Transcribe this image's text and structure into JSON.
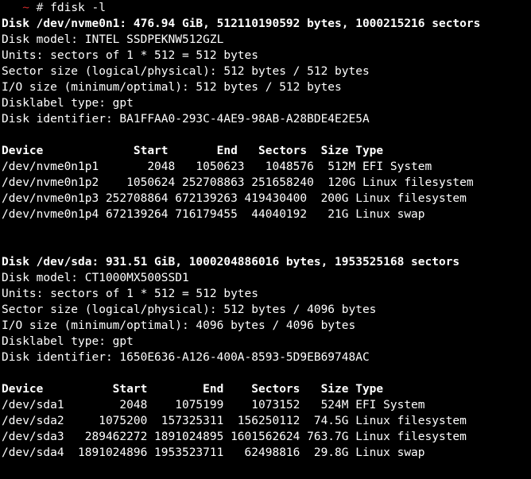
{
  "prompt": {
    "prefix": "   ",
    "tilde": "~",
    "hash": " # ",
    "command": "fdisk -l"
  },
  "disks": [
    {
      "header": "Disk /dev/nvme0n1: 476.94 GiB, 512110190592 bytes, 1000215216 sectors",
      "info": [
        "Disk model: INTEL SSDPEKNW512GZL",
        "Units: sectors of 1 * 512 = 512 bytes",
        "Sector size (logical/physical): 512 bytes / 512 bytes",
        "I/O size (minimum/optimal): 512 bytes / 512 bytes",
        "Disklabel type: gpt",
        "Disk identifier: BA1FFAA0-293C-4AE9-98AB-A28BDE4E2E5A"
      ],
      "table_header": "Device             Start       End   Sectors  Size Type",
      "rows": [
        "/dev/nvme0n1p1       2048   1050623   1048576  512M EFI System",
        "/dev/nvme0n1p2    1050624 252708863 251658240  120G Linux filesystem",
        "/dev/nvme0n1p3 252708864 672139263 419430400  200G Linux filesystem",
        "/dev/nvme0n1p4 672139264 716179455  44040192   21G Linux swap"
      ]
    },
    {
      "header": "Disk /dev/sda: 931.51 GiB, 1000204886016 bytes, 1953525168 sectors",
      "info": [
        "Disk model: CT1000MX500SSD1",
        "Units: sectors of 1 * 512 = 512 bytes",
        "Sector size (logical/physical): 512 bytes / 4096 bytes",
        "I/O size (minimum/optimal): 4096 bytes / 4096 bytes",
        "Disklabel type: gpt",
        "Disk identifier: 1650E636-A126-400A-8593-5D9EB69748AC"
      ],
      "table_header": "Device          Start        End    Sectors   Size Type",
      "rows": [
        "/dev/sda1        2048    1075199    1073152   524M EFI System",
        "/dev/sda2     1075200  157325311  156250112  74.5G Linux filesystem",
        "/dev/sda3   289462272 1891024895 1601562624 763.7G Linux filesystem",
        "/dev/sda4  1891024896 1953523711   62498816  29.8G Linux swap"
      ]
    }
  ]
}
